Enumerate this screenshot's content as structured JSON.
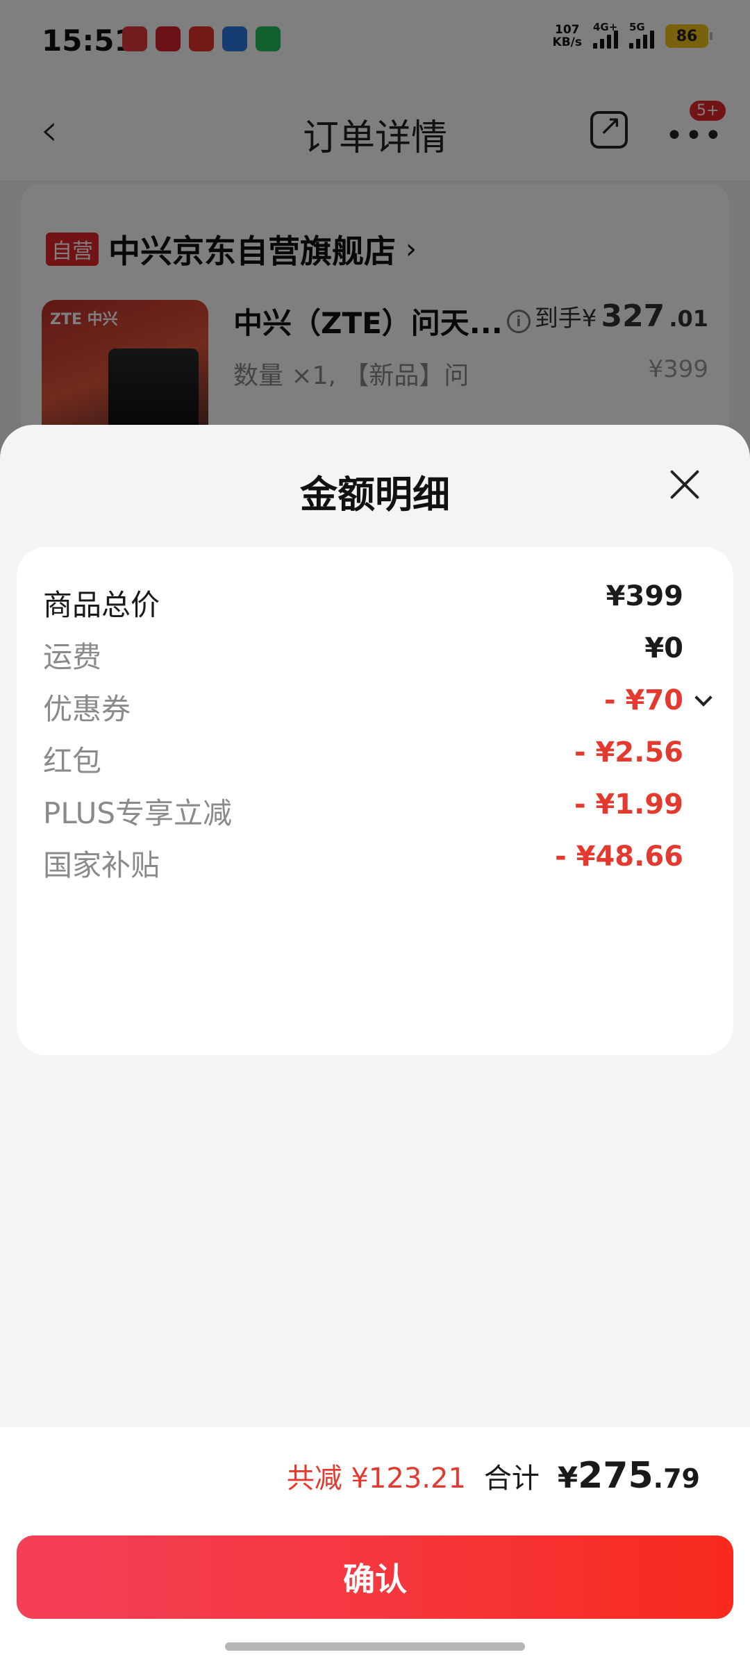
{
  "status_bar": {
    "time": "15:51",
    "net_speed_value": "107",
    "net_speed_unit": "KB/s",
    "signal1_label": "4G+",
    "signal2_label": "5G",
    "battery": "86"
  },
  "nav": {
    "title": "订单详情",
    "badge": "5+"
  },
  "order": {
    "self_tag": "自营",
    "store_name": "中兴京东自营旗舰店",
    "product_brand": "ZTE 中兴",
    "product_title": "中兴（ZTE）问天...",
    "product_spec": "数量 ×1, 【新品】问",
    "price_after_prefix": "到手¥",
    "price_after_int": "327",
    "price_after_dec": ".01",
    "price_original": "¥399"
  },
  "sheet": {
    "title": "金额明细",
    "rows": [
      {
        "label": "商品总价",
        "value": "¥399"
      },
      {
        "label": "运费",
        "value": "¥0"
      },
      {
        "label": "优惠券",
        "value": "- ¥70"
      },
      {
        "label": "红包",
        "value": "- ¥2.56"
      },
      {
        "label": "PLUS专享立减",
        "value": "- ¥1.99"
      },
      {
        "label": "国家补贴",
        "value": "- ¥48.66"
      }
    ],
    "summary": {
      "saved": "共减 ¥123.21",
      "total_label": "合计",
      "total_currency": "¥",
      "total_int": "275",
      "total_dec": ".79"
    },
    "confirm_label": "确认"
  },
  "colors": {
    "accent_red": "#e4392f",
    "button_gradient_start": "#f43f57",
    "button_gradient_end": "#f72a1c"
  }
}
